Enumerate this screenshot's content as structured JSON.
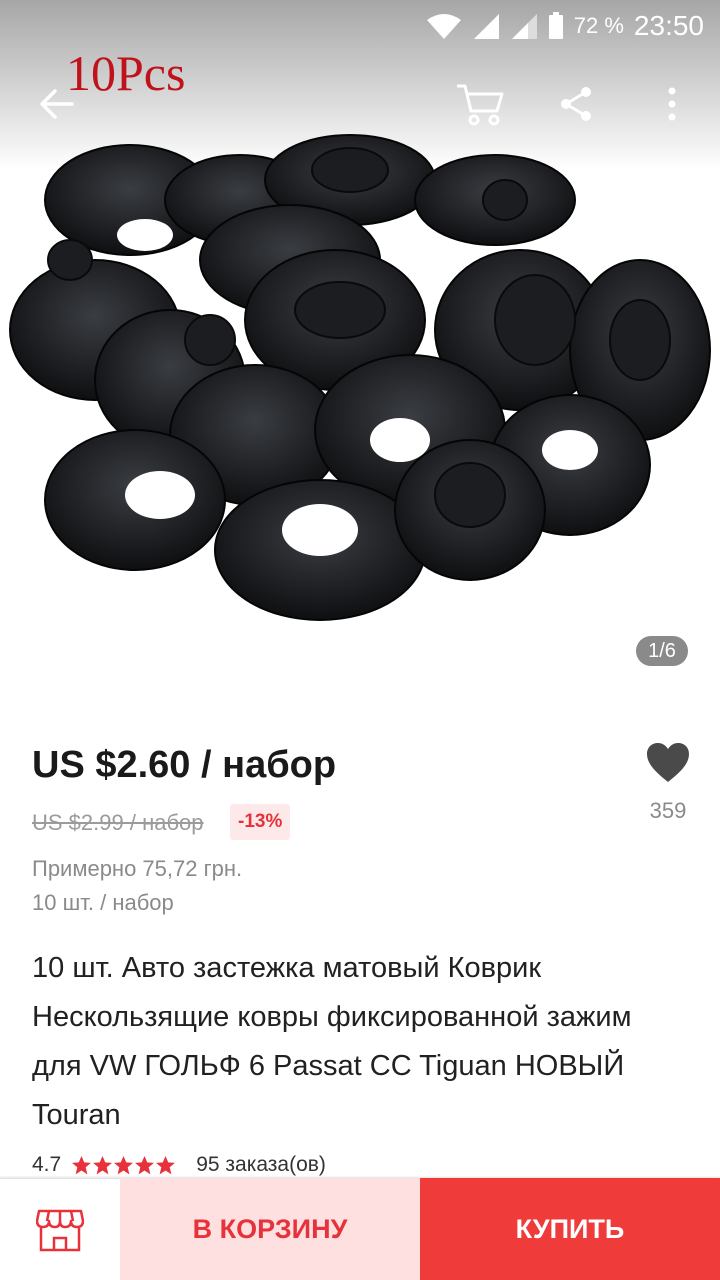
{
  "status_bar": {
    "battery": "72 %",
    "time": "23:50"
  },
  "gallery": {
    "promo_text": "10Pcs",
    "pager": "1/6"
  },
  "product": {
    "price": "US $2.60 / набор",
    "old_price": "US $2.99 / набор",
    "discount": "-13%",
    "approx_price": "Примерно 75,72 грн.",
    "unit": "10 шт. / набор",
    "title": "10 шт. Авто застежка матовый Коврик Нескользящие ковры фиксированной зажим для VW ГОЛЬФ 6 Passat CC Tiguan НОВЫЙ Touran",
    "rating": "4.7",
    "rating_stars": 5,
    "orders": "95 заказа(ов)",
    "wishlist_count": "359"
  },
  "actions": {
    "add_to_cart": "В КОРЗИНУ",
    "buy": "КУПИТЬ"
  },
  "colors": {
    "accent": "#f03b3b",
    "accent_light": "#fde0df",
    "star": "#e8323b"
  },
  "icons": [
    "back-arrow-icon",
    "cart-icon",
    "share-icon",
    "more-vertical-icon",
    "heart-icon",
    "store-icon",
    "star-icon",
    "wifi-icon",
    "signal-icon",
    "battery-icon"
  ]
}
